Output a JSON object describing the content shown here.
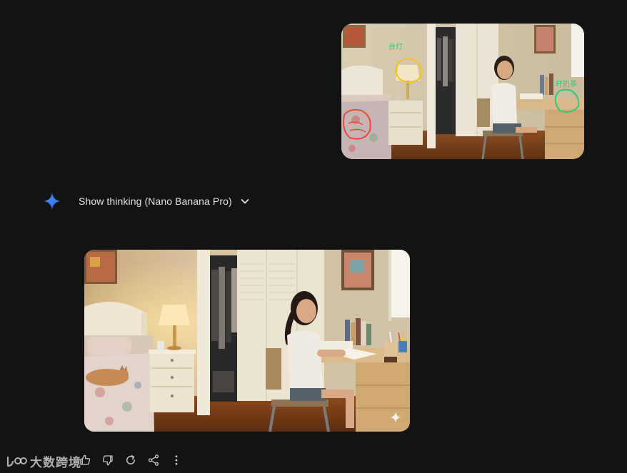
{
  "conversation": {
    "user_image": {
      "annotations": [
        {
          "label": "台灯",
          "color": "#f5c518"
        },
        {
          "label": "杯奶茶",
          "color": "#2ecc71"
        },
        {
          "label": "",
          "color": "#e74c3c"
        }
      ]
    },
    "response": {
      "thinking_label": "Show thinking (Nano Banana Pro)",
      "icon": "gemini-spark-icon",
      "accent_color": "#4285f4"
    },
    "actions": [
      {
        "icon": "thumb-up-icon"
      },
      {
        "icon": "thumb-down-icon"
      },
      {
        "icon": "regenerate-icon"
      },
      {
        "icon": "share-icon"
      },
      {
        "icon": "more-vert-icon"
      }
    ]
  },
  "watermark": {
    "text": "大数跨境"
  }
}
